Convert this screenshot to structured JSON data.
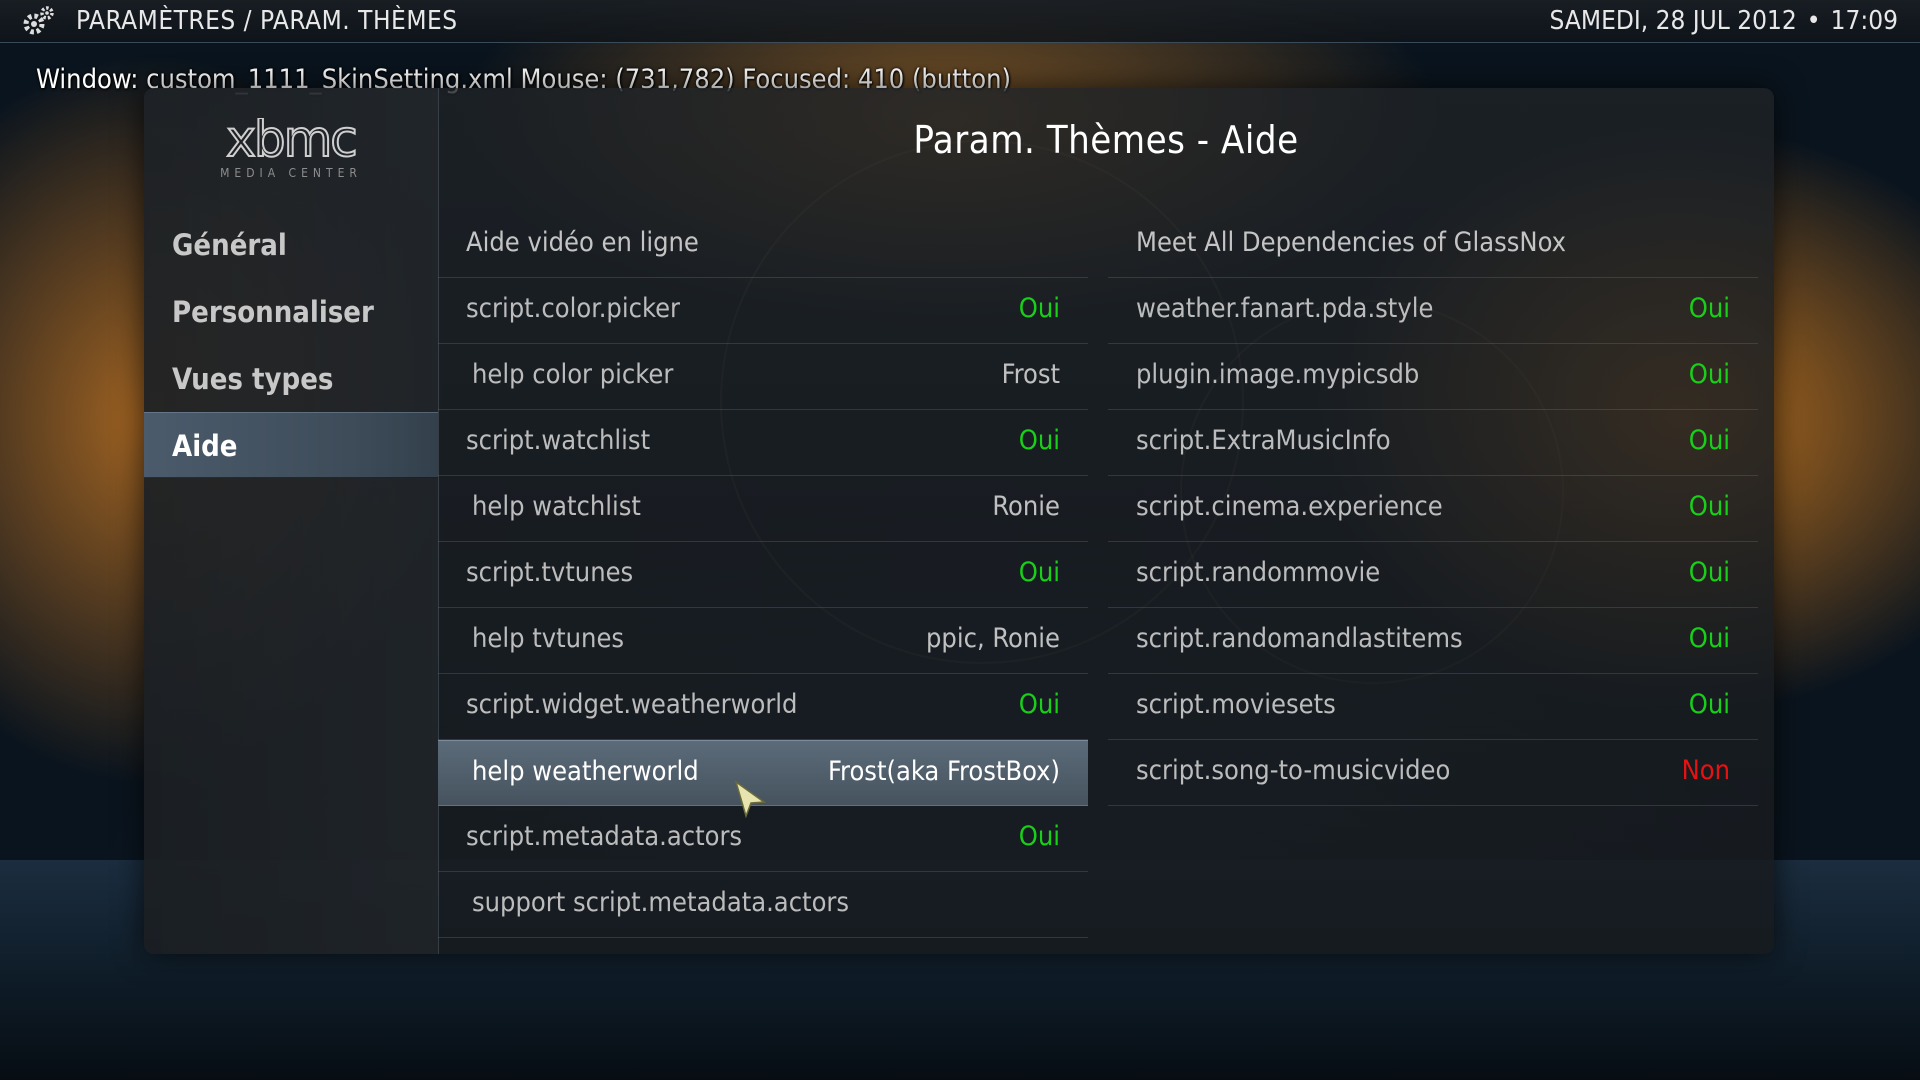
{
  "header": {
    "breadcrumb": "PARAMÈTRES / PARAM. THÈMES",
    "date": "SAMEDI, 28 JUL 2012",
    "separator": "•",
    "time": "17:09"
  },
  "debug_overlay": "Window: custom_1111_SkinSetting.xml  Mouse: (731,782)  Focused: 410 (button)",
  "logo": {
    "text": "xbmc",
    "subtitle": "MEDIA CENTER"
  },
  "panel": {
    "title": "Param. Thèmes - Aide"
  },
  "sidebar": {
    "items": [
      {
        "label": "Général",
        "active": false
      },
      {
        "label": "Personnaliser",
        "active": false
      },
      {
        "label": "Vues types",
        "active": false
      },
      {
        "label": "Aide",
        "active": true
      }
    ]
  },
  "left_list": {
    "header": "Aide vidéo en ligne",
    "rows": [
      {
        "label": "script.color.picker",
        "value": "Oui"
      },
      {
        "label": "help color picker",
        "value": "Frost"
      },
      {
        "label": "script.watchlist",
        "value": "Oui"
      },
      {
        "label": "help watchlist",
        "value": "Ronie"
      },
      {
        "label": "script.tvtunes",
        "value": "Oui"
      },
      {
        "label": "help tvtunes",
        "value": "ppic, Ronie"
      },
      {
        "label": "script.widget.weatherworld",
        "value": "Oui"
      },
      {
        "label": "help weatherworld",
        "value": "Frost(aka FrostBox)"
      },
      {
        "label": "script.metadata.actors",
        "value": "Oui"
      },
      {
        "label": "support script.metadata.actors",
        "value": ""
      }
    ]
  },
  "right_list": {
    "header": "Meet All Dependencies of GlassNox",
    "rows": [
      {
        "label": "weather.fanart.pda.style",
        "value": "Oui"
      },
      {
        "label": "plugin.image.mypicsdb",
        "value": "Oui"
      },
      {
        "label": "script.ExtraMusicInfo",
        "value": "Oui"
      },
      {
        "label": "script.cinema.experience",
        "value": "Oui"
      },
      {
        "label": "script.randommovie",
        "value": "Oui"
      },
      {
        "label": "script.randomandlastitems",
        "value": "Oui"
      },
      {
        "label": "script.moviesets",
        "value": "Oui"
      },
      {
        "label": "script.song-to-musicvideo",
        "value": "Non"
      }
    ]
  },
  "colors": {
    "yes": "#19d019",
    "no": "#e51212",
    "focus": "#52606d"
  }
}
